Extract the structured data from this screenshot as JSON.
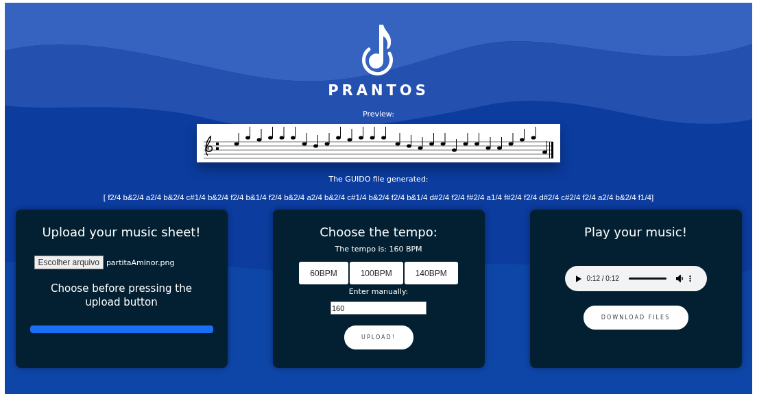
{
  "brand": {
    "name": "PRANTOS"
  },
  "preview": {
    "label": "Preview:"
  },
  "guido": {
    "label": "The GUIDO file generated:",
    "text": "[ f2/4 b&2/4 a2/4 b&2/4 c#1/4 b&2/4 f2/4 b&1/4 f2/4 b&2/4 a2/4 b&2/4 c#1/4 b&2/4 f2/4 b&1/4 d#2/4 f2/4 f#2/4 a1/4 f#2/4 f2/4 d#2/4 c#2/4 f2/4 a2/4 b&2/4 f1/4]"
  },
  "upload_card": {
    "title": "Upload your music sheet!",
    "file_button": "Escolher arquivo",
    "file_name": "partitaAminor.png",
    "hint": "Choose before pressing the upload button",
    "progress": {
      "level": 1
    }
  },
  "tempo_card": {
    "title": "Choose the tempo:",
    "current": "The tempo is: 160 BPM",
    "presets": [
      {
        "label": "60BPM",
        "selected": false
      },
      {
        "label": "100BPM",
        "selected": false
      },
      {
        "label": "140BPM",
        "selected": false
      }
    ],
    "manual_label": "Enter manually:",
    "manual_value": "160",
    "upload_button": "UPLOAD!"
  },
  "play_card": {
    "title": "Play your music!",
    "player": {
      "time": "0:12 / 0:12",
      "level": 1
    },
    "download_button": "DOWNLOAD FILES"
  }
}
